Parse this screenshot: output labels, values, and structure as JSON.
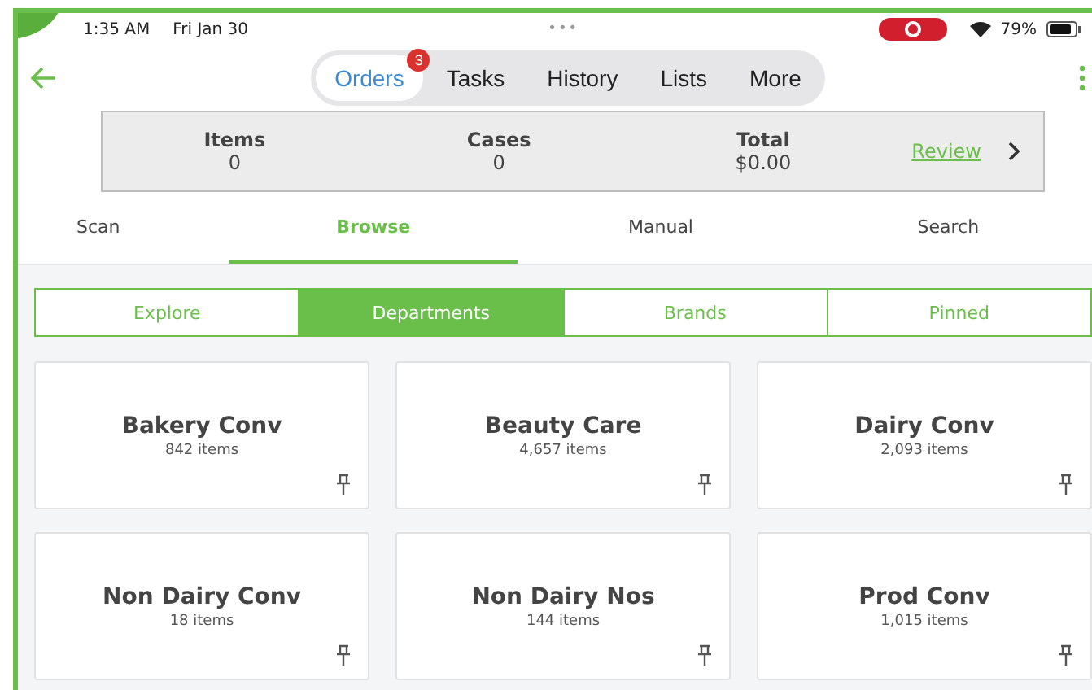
{
  "status_bar": {
    "time": "1:35 AM",
    "date": "Fri Jan 30",
    "dots": "•••",
    "battery": "79%"
  },
  "nav_tabs": [
    {
      "label": "Orders",
      "selected": true,
      "badge": "3"
    },
    {
      "label": "Tasks",
      "selected": false
    },
    {
      "label": "History",
      "selected": false
    },
    {
      "label": "Lists",
      "selected": false
    },
    {
      "label": "More",
      "selected": false
    }
  ],
  "summary": {
    "stats": [
      {
        "label": "Items",
        "value": "0"
      },
      {
        "label": "Cases",
        "value": "0"
      },
      {
        "label": "Total",
        "value": "$0.00"
      }
    ],
    "review_link": "Review"
  },
  "mode_tabs": [
    {
      "label": "Scan",
      "selected": false
    },
    {
      "label": "Browse",
      "selected": true
    },
    {
      "label": "Manual",
      "selected": false
    },
    {
      "label": "Search",
      "selected": false
    }
  ],
  "segments": [
    {
      "label": "Explore",
      "selected": false
    },
    {
      "label": "Departments",
      "selected": true
    },
    {
      "label": "Brands",
      "selected": false
    },
    {
      "label": "Pinned",
      "selected": false
    }
  ],
  "departments": [
    {
      "name": "Bakery Conv",
      "count": "842 items"
    },
    {
      "name": "Beauty Care",
      "count": "4,657 items"
    },
    {
      "name": "Dairy Conv",
      "count": "2,093 items"
    },
    {
      "name": "Non Dairy Conv",
      "count": "18 items"
    },
    {
      "name": "Non Dairy Nos",
      "count": "144 items"
    },
    {
      "name": "Prod Conv",
      "count": "1,015 items"
    }
  ]
}
